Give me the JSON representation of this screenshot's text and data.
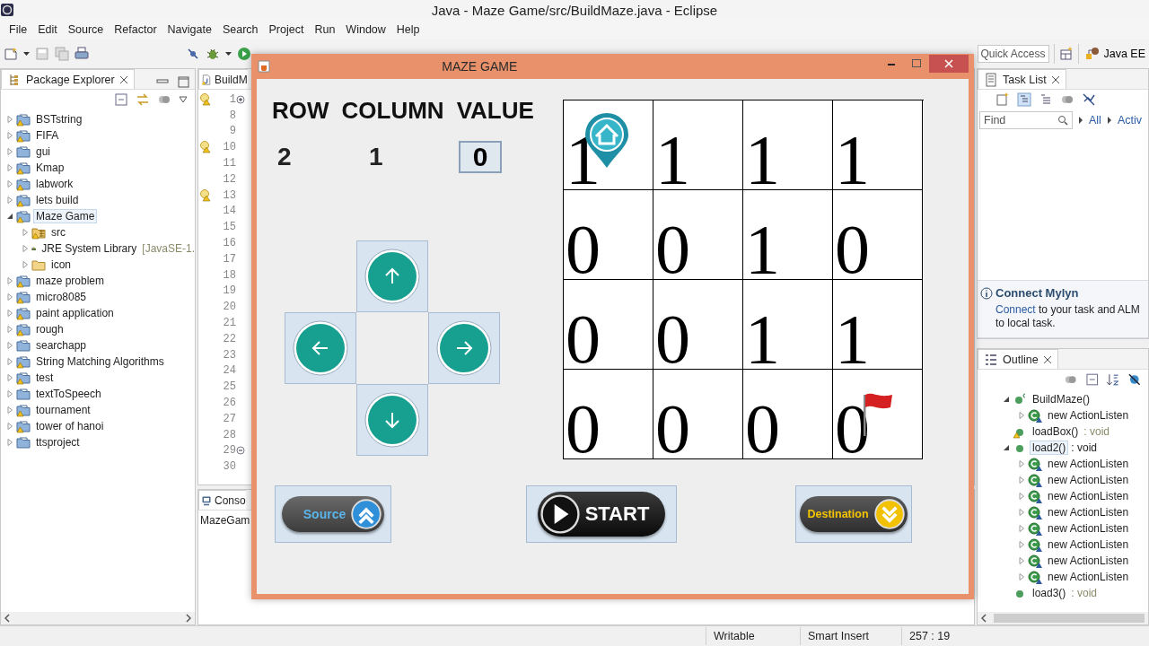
{
  "window": {
    "title": "Java - Maze Game/src/BuildMaze.java - Eclipse"
  },
  "menu": [
    "File",
    "Edit",
    "Source",
    "Refactor",
    "Navigate",
    "Search",
    "Project",
    "Run",
    "Window",
    "Help"
  ],
  "toolbar": {
    "quick_access": {
      "placeholder": "Quick Access"
    },
    "perspective": "Java EE"
  },
  "package_explorer": {
    "tab": "Package Explorer",
    "items": [
      {
        "label": "BSTstring",
        "kind": "project",
        "warning": true,
        "expanded": false,
        "selected": false
      },
      {
        "label": "FIFA",
        "kind": "project",
        "warning": true,
        "expanded": false,
        "selected": false
      },
      {
        "label": "gui",
        "kind": "project",
        "warning": false,
        "expanded": false,
        "selected": false
      },
      {
        "label": "Kmap",
        "kind": "project",
        "warning": true,
        "expanded": false,
        "selected": false
      },
      {
        "label": "labwork",
        "kind": "project",
        "warning": true,
        "expanded": false,
        "selected": false
      },
      {
        "label": "lets build",
        "kind": "project",
        "warning": true,
        "expanded": false,
        "selected": false
      },
      {
        "label": "Maze Game",
        "kind": "project",
        "warning": true,
        "expanded": true,
        "selected": true,
        "children": [
          {
            "label": "src",
            "kind": "source-folder",
            "warning": true,
            "expanded": false,
            "selected": false
          },
          {
            "label": "JRE System Library",
            "detail": "[JavaSE-1.",
            "kind": "library",
            "warning": false,
            "expanded": false,
            "selected": false
          },
          {
            "label": "icon",
            "kind": "folder",
            "warning": false,
            "expanded": false,
            "selected": false
          }
        ]
      },
      {
        "label": "maze problem",
        "kind": "project",
        "warning": true,
        "expanded": false,
        "selected": false
      },
      {
        "label": "micro8085",
        "kind": "project",
        "warning": true,
        "expanded": false,
        "selected": false
      },
      {
        "label": "paint application",
        "kind": "project",
        "warning": true,
        "expanded": false,
        "selected": false
      },
      {
        "label": "rough",
        "kind": "project",
        "warning": true,
        "expanded": false,
        "selected": false
      },
      {
        "label": "searchapp",
        "kind": "project",
        "warning": false,
        "expanded": false,
        "selected": false
      },
      {
        "label": "String Matching Algorithms",
        "kind": "project",
        "warning": true,
        "expanded": false,
        "selected": false
      },
      {
        "label": "test",
        "kind": "project",
        "warning": true,
        "expanded": false,
        "selected": false
      },
      {
        "label": "textToSpeech",
        "kind": "project",
        "warning": false,
        "expanded": false,
        "selected": false
      },
      {
        "label": "tournament",
        "kind": "project",
        "warning": true,
        "expanded": false,
        "selected": false
      },
      {
        "label": "tower of hanoi",
        "kind": "project",
        "warning": true,
        "expanded": false,
        "selected": false
      },
      {
        "label": "ttsproject",
        "kind": "project",
        "warning": false,
        "expanded": false,
        "selected": false
      }
    ]
  },
  "editor": {
    "tab": "BuildM",
    "lines": [
      {
        "number": "1",
        "warning": true,
        "folded": true
      },
      {
        "number": "8",
        "warning": false
      },
      {
        "number": "9",
        "warning": false
      },
      {
        "number": "10",
        "warning": true
      },
      {
        "number": "11",
        "warning": false
      },
      {
        "number": "12",
        "warning": false
      },
      {
        "number": "13",
        "warning": true
      },
      {
        "number": "14",
        "warning": false
      },
      {
        "number": "15",
        "warning": false
      },
      {
        "number": "16",
        "warning": false
      },
      {
        "number": "17",
        "warning": false
      },
      {
        "number": "18",
        "warning": false
      },
      {
        "number": "19",
        "warning": false
      },
      {
        "number": "20",
        "warning": false
      },
      {
        "number": "21",
        "warning": false
      },
      {
        "number": "22",
        "warning": false
      },
      {
        "number": "23",
        "warning": false
      },
      {
        "number": "24",
        "warning": false
      },
      {
        "number": "25",
        "warning": false
      },
      {
        "number": "26",
        "warning": false
      },
      {
        "number": "27",
        "warning": false
      },
      {
        "number": "28",
        "warning": false
      },
      {
        "number": "29",
        "warning": false,
        "folded": false
      },
      {
        "number": "30",
        "warning": false
      }
    ]
  },
  "console": {
    "tab": "Conso",
    "label": "MazeGam"
  },
  "task_list": {
    "tab": "Task List",
    "find": {
      "placeholder": "Find"
    },
    "filters": [
      "All",
      "Activ"
    ],
    "mylyn": {
      "title": "Connect Mylyn",
      "link": "Connect",
      "text": " to your task and ALM to local task."
    }
  },
  "outline": {
    "tab": "Outline",
    "items": [
      {
        "label": "BuildMaze()",
        "kind": "constructor",
        "warning": false,
        "expanded": true,
        "selected": false,
        "children": [
          {
            "label": "new ActionListen",
            "kind": "anonymous",
            "warning": false,
            "expanded": false,
            "selected": false
          }
        ]
      },
      {
        "label": "loadBox()",
        "detail": " : void",
        "kind": "method",
        "warning": true,
        "selected": false
      },
      {
        "label": "load2()",
        "detail": " : void",
        "kind": "method",
        "warning": false,
        "expanded": true,
        "selected": true,
        "children": [
          {
            "label": "new ActionListen",
            "kind": "anonymous",
            "warning": false,
            "expanded": false,
            "selected": false
          },
          {
            "label": "new ActionListen",
            "kind": "anonymous",
            "warning": false,
            "expanded": false,
            "selected": false
          },
          {
            "label": "new ActionListen",
            "kind": "anonymous",
            "warning": false,
            "expanded": false,
            "selected": false
          },
          {
            "label": "new ActionListen",
            "kind": "anonymous",
            "warning": false,
            "expanded": false,
            "selected": false
          },
          {
            "label": "new ActionListen",
            "kind": "anonymous",
            "warning": false,
            "expanded": false,
            "selected": false
          },
          {
            "label": "new ActionListen",
            "kind": "anonymous",
            "warning": false,
            "expanded": false,
            "selected": false
          },
          {
            "label": "new ActionListen",
            "kind": "anonymous",
            "warning": false,
            "expanded": false,
            "selected": false
          },
          {
            "label": "new ActionListen",
            "kind": "anonymous",
            "warning": false,
            "expanded": false,
            "selected": false
          }
        ]
      },
      {
        "label": "load3()",
        "detail": " : void",
        "kind": "method",
        "warning": false,
        "selected": false
      }
    ]
  },
  "status": [
    "Writable",
    "Smart Insert",
    "257 : 19"
  ],
  "maze": {
    "title": "MAZE GAME",
    "headings": [
      "ROW",
      "COLUMN",
      "VALUE"
    ],
    "row": "2",
    "column": "1",
    "value": "0",
    "pad": [
      {
        "kind": "up"
      },
      {
        "kind": "left"
      },
      {
        "kind": "right"
      },
      {
        "kind": "down"
      }
    ],
    "grid": [
      [
        {
          "value": "1",
          "kind": "home"
        },
        {
          "value": "1",
          "kind": "plain"
        },
        {
          "value": "1",
          "kind": "plain"
        },
        {
          "value": "1",
          "kind": "plain"
        }
      ],
      [
        {
          "value": "0",
          "kind": "plain"
        },
        {
          "value": "0",
          "kind": "plain"
        },
        {
          "value": "1",
          "kind": "plain"
        },
        {
          "value": "0",
          "kind": "plain"
        }
      ],
      [
        {
          "value": "0",
          "kind": "plain"
        },
        {
          "value": "0",
          "kind": "plain"
        },
        {
          "value": "1",
          "kind": "plain"
        },
        {
          "value": "1",
          "kind": "plain"
        }
      ],
      [
        {
          "value": "0",
          "kind": "plain"
        },
        {
          "value": "0",
          "kind": "plain"
        },
        {
          "value": "0",
          "kind": "plain"
        },
        {
          "value": "0",
          "kind": "flag"
        }
      ]
    ],
    "actions": [
      {
        "label": "Source",
        "kind": "source"
      },
      {
        "label": "START",
        "kind": "start"
      },
      {
        "label": "Destination",
        "kind": "destination"
      }
    ]
  }
}
